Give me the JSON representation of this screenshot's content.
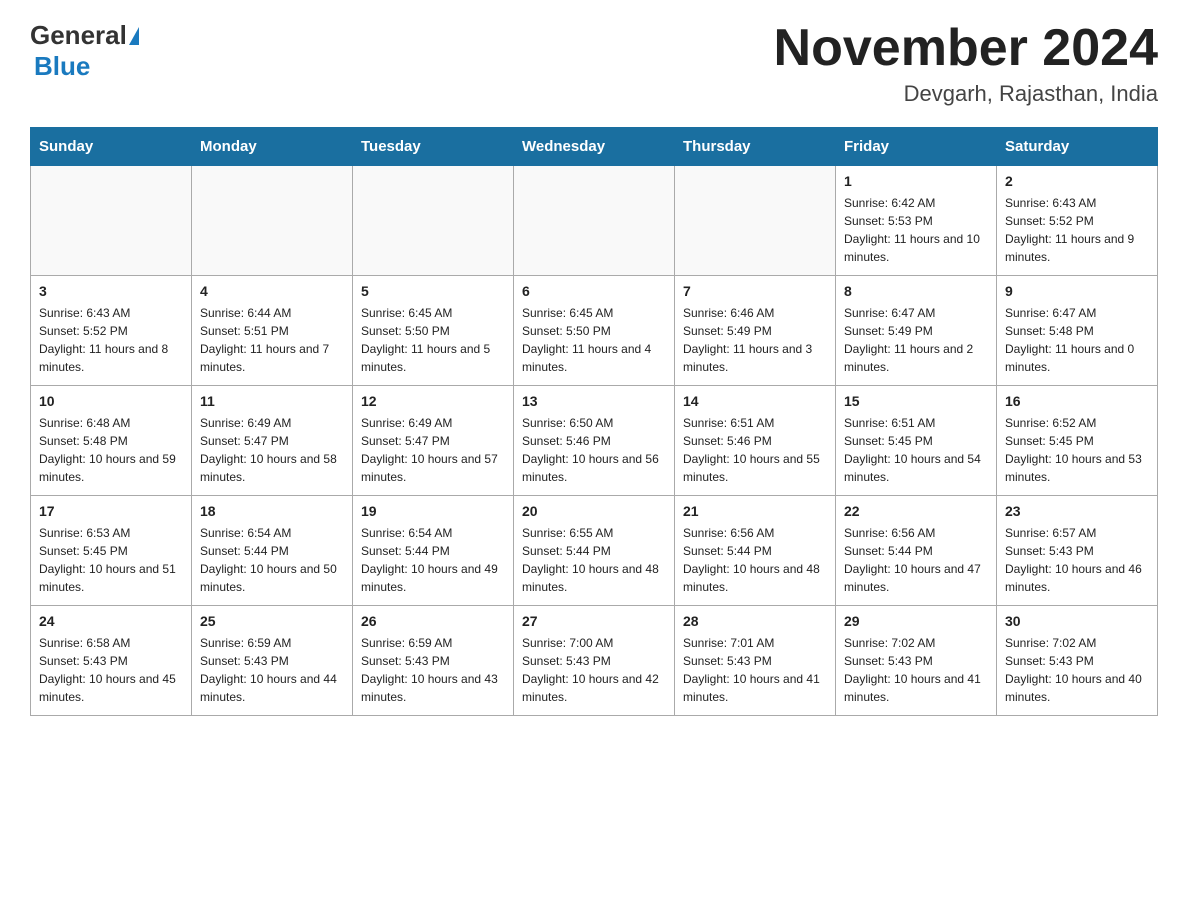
{
  "header": {
    "logo_general": "General",
    "logo_blue": "Blue",
    "month_title": "November 2024",
    "location": "Devgarh, Rajasthan, India"
  },
  "weekdays": [
    "Sunday",
    "Monday",
    "Tuesday",
    "Wednesday",
    "Thursday",
    "Friday",
    "Saturday"
  ],
  "weeks": [
    {
      "days": [
        {
          "num": "",
          "info": ""
        },
        {
          "num": "",
          "info": ""
        },
        {
          "num": "",
          "info": ""
        },
        {
          "num": "",
          "info": ""
        },
        {
          "num": "",
          "info": ""
        },
        {
          "num": "1",
          "info": "Sunrise: 6:42 AM\nSunset: 5:53 PM\nDaylight: 11 hours and 10 minutes."
        },
        {
          "num": "2",
          "info": "Sunrise: 6:43 AM\nSunset: 5:52 PM\nDaylight: 11 hours and 9 minutes."
        }
      ]
    },
    {
      "days": [
        {
          "num": "3",
          "info": "Sunrise: 6:43 AM\nSunset: 5:52 PM\nDaylight: 11 hours and 8 minutes."
        },
        {
          "num": "4",
          "info": "Sunrise: 6:44 AM\nSunset: 5:51 PM\nDaylight: 11 hours and 7 minutes."
        },
        {
          "num": "5",
          "info": "Sunrise: 6:45 AM\nSunset: 5:50 PM\nDaylight: 11 hours and 5 minutes."
        },
        {
          "num": "6",
          "info": "Sunrise: 6:45 AM\nSunset: 5:50 PM\nDaylight: 11 hours and 4 minutes."
        },
        {
          "num": "7",
          "info": "Sunrise: 6:46 AM\nSunset: 5:49 PM\nDaylight: 11 hours and 3 minutes."
        },
        {
          "num": "8",
          "info": "Sunrise: 6:47 AM\nSunset: 5:49 PM\nDaylight: 11 hours and 2 minutes."
        },
        {
          "num": "9",
          "info": "Sunrise: 6:47 AM\nSunset: 5:48 PM\nDaylight: 11 hours and 0 minutes."
        }
      ]
    },
    {
      "days": [
        {
          "num": "10",
          "info": "Sunrise: 6:48 AM\nSunset: 5:48 PM\nDaylight: 10 hours and 59 minutes."
        },
        {
          "num": "11",
          "info": "Sunrise: 6:49 AM\nSunset: 5:47 PM\nDaylight: 10 hours and 58 minutes."
        },
        {
          "num": "12",
          "info": "Sunrise: 6:49 AM\nSunset: 5:47 PM\nDaylight: 10 hours and 57 minutes."
        },
        {
          "num": "13",
          "info": "Sunrise: 6:50 AM\nSunset: 5:46 PM\nDaylight: 10 hours and 56 minutes."
        },
        {
          "num": "14",
          "info": "Sunrise: 6:51 AM\nSunset: 5:46 PM\nDaylight: 10 hours and 55 minutes."
        },
        {
          "num": "15",
          "info": "Sunrise: 6:51 AM\nSunset: 5:45 PM\nDaylight: 10 hours and 54 minutes."
        },
        {
          "num": "16",
          "info": "Sunrise: 6:52 AM\nSunset: 5:45 PM\nDaylight: 10 hours and 53 minutes."
        }
      ]
    },
    {
      "days": [
        {
          "num": "17",
          "info": "Sunrise: 6:53 AM\nSunset: 5:45 PM\nDaylight: 10 hours and 51 minutes."
        },
        {
          "num": "18",
          "info": "Sunrise: 6:54 AM\nSunset: 5:44 PM\nDaylight: 10 hours and 50 minutes."
        },
        {
          "num": "19",
          "info": "Sunrise: 6:54 AM\nSunset: 5:44 PM\nDaylight: 10 hours and 49 minutes."
        },
        {
          "num": "20",
          "info": "Sunrise: 6:55 AM\nSunset: 5:44 PM\nDaylight: 10 hours and 48 minutes."
        },
        {
          "num": "21",
          "info": "Sunrise: 6:56 AM\nSunset: 5:44 PM\nDaylight: 10 hours and 48 minutes."
        },
        {
          "num": "22",
          "info": "Sunrise: 6:56 AM\nSunset: 5:44 PM\nDaylight: 10 hours and 47 minutes."
        },
        {
          "num": "23",
          "info": "Sunrise: 6:57 AM\nSunset: 5:43 PM\nDaylight: 10 hours and 46 minutes."
        }
      ]
    },
    {
      "days": [
        {
          "num": "24",
          "info": "Sunrise: 6:58 AM\nSunset: 5:43 PM\nDaylight: 10 hours and 45 minutes."
        },
        {
          "num": "25",
          "info": "Sunrise: 6:59 AM\nSunset: 5:43 PM\nDaylight: 10 hours and 44 minutes."
        },
        {
          "num": "26",
          "info": "Sunrise: 6:59 AM\nSunset: 5:43 PM\nDaylight: 10 hours and 43 minutes."
        },
        {
          "num": "27",
          "info": "Sunrise: 7:00 AM\nSunset: 5:43 PM\nDaylight: 10 hours and 42 minutes."
        },
        {
          "num": "28",
          "info": "Sunrise: 7:01 AM\nSunset: 5:43 PM\nDaylight: 10 hours and 41 minutes."
        },
        {
          "num": "29",
          "info": "Sunrise: 7:02 AM\nSunset: 5:43 PM\nDaylight: 10 hours and 41 minutes."
        },
        {
          "num": "30",
          "info": "Sunrise: 7:02 AM\nSunset: 5:43 PM\nDaylight: 10 hours and 40 minutes."
        }
      ]
    }
  ]
}
